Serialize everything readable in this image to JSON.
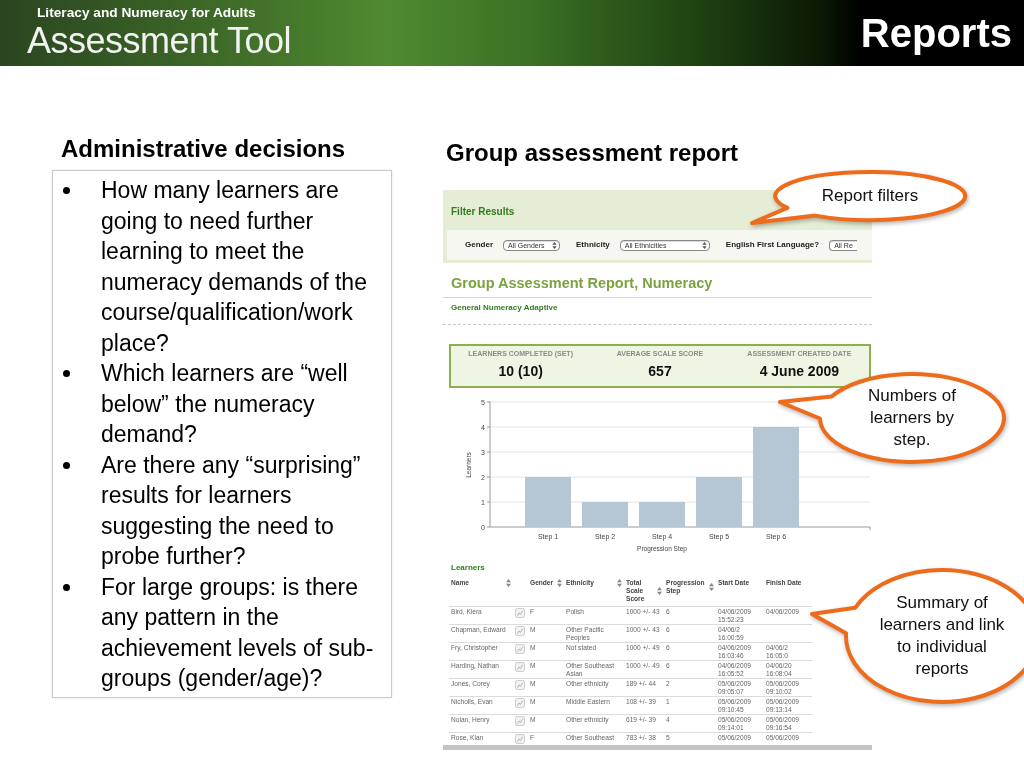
{
  "header": {
    "tagline": "Literacy and Numeracy for Adults",
    "logo": "Assessment Tool",
    "title": "Reports"
  },
  "left_panel": {
    "heading": "Administrative decisions",
    "bullets": [
      "How many learners are going to need further learning to meet the numeracy demands of the course/qualification/work place?",
      "Which learners are “well below” the numeracy demand?",
      "Are there any “surprising” results for learners suggesting the need to probe further?",
      "For large groups: is there any pattern in the achievement levels of sub-groups (gender/age)?"
    ]
  },
  "right_panel": {
    "heading": "Group assessment report",
    "report": {
      "filter": {
        "title": "Filter Results",
        "fields": [
          {
            "label": "Gender",
            "value": "All Genders",
            "truncated": false
          },
          {
            "label": "Ethnicity",
            "value": "All Ethnicities",
            "truncated": false
          },
          {
            "label": "English First Language?",
            "value": "All Re",
            "truncated": true
          }
        ]
      },
      "title": "Group Assessment Report, Numeracy",
      "subtitle": "General Numeracy Adaptive",
      "summary": [
        {
          "label": "LEARNERS COMPLETED (SET)",
          "value": "10 (10)"
        },
        {
          "label": "AVERAGE SCALE SCORE",
          "value": "657"
        },
        {
          "label": "ASSESSMENT CREATED DATE",
          "value": "4 June 2009"
        }
      ],
      "chart_data": {
        "type": "bar",
        "xlabel": "Progression Step",
        "ylabel": "Learners",
        "categories": [
          "Step 1",
          "Step 2",
          "Step 4",
          "Step 5",
          "Step 6"
        ],
        "values": [
          2,
          1,
          1,
          2,
          4
        ],
        "ylim": [
          0,
          5
        ],
        "yticks": [
          0,
          1,
          2,
          3,
          4,
          5
        ],
        "grid": true
      },
      "learners": {
        "title": "Learners",
        "columns": [
          {
            "label": "Name",
            "sortable": true
          },
          {
            "label": "Gender",
            "sortable": true
          },
          {
            "label": "Ethnicity",
            "sortable": true
          },
          {
            "label": "Total Scale Score",
            "sortable": true
          },
          {
            "label": "Progression Step",
            "sortable": true
          },
          {
            "label": "Start Date",
            "sortable": false
          },
          {
            "label": "Finish Date",
            "sortable": false
          }
        ],
        "rows": [
          {
            "cells": [
              "Bird, Kiera",
              "F",
              "Polish",
              "1000 +/- 43",
              "6",
              "04/06/2009 15:52:23",
              "04/06/2009"
            ]
          },
          {
            "cells": [
              "Chapman, Edward",
              "M",
              "Other Pacific Peoples",
              "1000 +/- 43",
              "6",
              "04/06/2 16:00:59"
            ]
          },
          {
            "cells": [
              "Fry, Christopher",
              "M",
              "Not stated",
              "1000 +/- 49",
              "6",
              "04/06/2009 16:03:46",
              "04/06/2 16:05:0"
            ]
          },
          {
            "cells": [
              "Harding, Nathan",
              "M",
              "Other Southeast Asian",
              "1000 +/- 49",
              "6",
              "04/06/2009 16:05:52",
              "04/06/20 16:08:04"
            ]
          },
          {
            "cells": [
              "Jones, Corey",
              "M",
              "Other ethnicity",
              "189 +/- 44",
              "2",
              "05/06/2009 09:05:07",
              "05/06/2009 09:10:02"
            ]
          },
          {
            "cells": [
              "Nicholls, Evan",
              "M",
              "Middle Eastern",
              "108 +/- 39",
              "1",
              "05/06/2009 09:10:45",
              "05/06/2009 09:13:14"
            ]
          },
          {
            "cells": [
              "Nolan, Henry",
              "M",
              "Other ethnicity",
              "619 +/- 39",
              "4",
              "05/06/2009 09:14:01",
              "05/06/2009 09:16:54"
            ]
          },
          {
            "cells": [
              "Rose, Kian",
              "F",
              "Other Southeast",
              "783 +/- 38",
              "5",
              "05/06/2009",
              "05/06/2009"
            ]
          }
        ]
      }
    }
  },
  "callouts": [
    {
      "text": "Report filters"
    },
    {
      "text": "Numbers of learners by step."
    },
    {
      "text": "Summary of learners and link to individual reports"
    }
  ]
}
